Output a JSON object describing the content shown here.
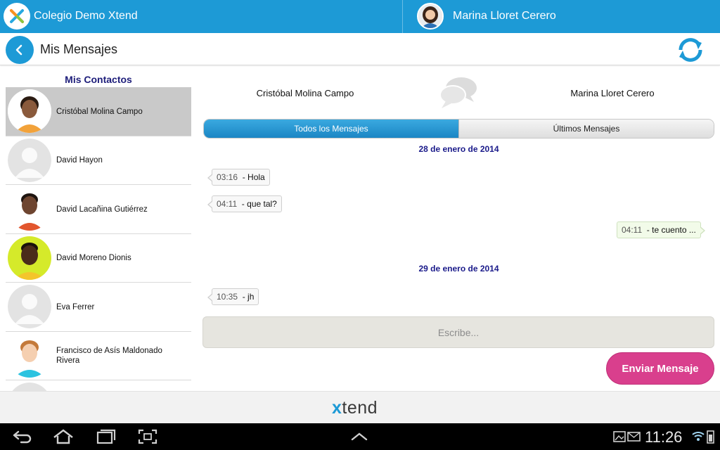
{
  "app": {
    "school_name": "Colegio Demo Xtend",
    "user_name": "Marina Lloret Cerero",
    "accent": "#1d9ad6"
  },
  "titlebar": {
    "title": "Mis Mensajes",
    "back_icon": "chevron-left-icon",
    "refresh_icon": "refresh-icon"
  },
  "contacts": {
    "title": "Mis Contactos",
    "items": [
      {
        "name": "Cristóbal Molina Campo",
        "active": true
      },
      {
        "name": "David Hayon",
        "active": false
      },
      {
        "name": "David Lacañina Gutiérrez",
        "active": false
      },
      {
        "name": "David Moreno Dionis",
        "active": false
      },
      {
        "name": "Eva Ferrer",
        "active": false
      },
      {
        "name": "Francisco de Asís Maldonado Rivera",
        "active": false
      }
    ]
  },
  "conversation": {
    "left_participant": "Cristóbal Molina Campo",
    "right_participant": "Marina Lloret Cerero",
    "tabs": [
      {
        "label": "Todos los Mensajes",
        "active": true
      },
      {
        "label": "Últimos Mensajes",
        "active": false
      }
    ],
    "dates": [
      "28 de enero de 2014",
      "29 de enero de 2014"
    ],
    "messages": [
      {
        "time": "03:16",
        "text": "Hola",
        "direction": "in"
      },
      {
        "time": "04:11",
        "text": "que tal?",
        "direction": "in"
      },
      {
        "time": "04:11",
        "text": "te cuento ...",
        "direction": "out"
      },
      {
        "time": "10:35",
        "text": "jh",
        "direction": "in"
      }
    ],
    "compose_placeholder": "Escribe...",
    "send_label": "Enviar Mensaje"
  },
  "footer": {
    "logo_x": "x",
    "logo_text": "tend"
  },
  "system": {
    "clock": "11:26"
  }
}
